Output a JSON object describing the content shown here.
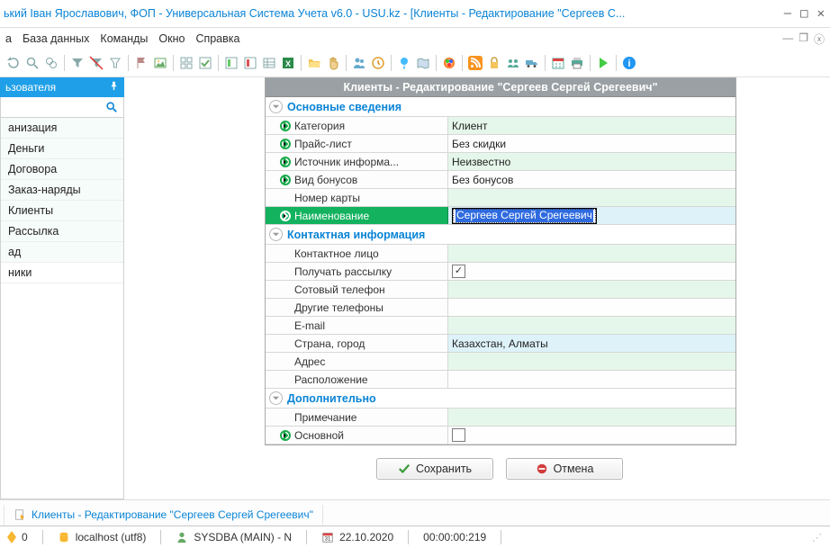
{
  "title": "ький Іван Ярославович, ФОП - Универсальная Система Учета v6.0 - USU.kz - [Клиенты - Редактирование \"Сергеев С...",
  "menu": {
    "m1": "а",
    "m2": "База данных",
    "m3": "Команды",
    "m4": "Окно",
    "m5": "Справка"
  },
  "sidebar": {
    "header": "ьзователя",
    "items": [
      "анизация",
      "Деньги",
      "Договора",
      "Заказ-наряды",
      "Клиенты",
      "Рассылка",
      "ад",
      "ники"
    ]
  },
  "form": {
    "title": "Клиенты - Редактирование \"Сергеев Сергей Срегеевич\"",
    "sections": {
      "main": "Основные сведения",
      "contact": "Контактная информация",
      "extra": "Дополнительно"
    },
    "labels": {
      "category": "Категория",
      "pricelist": "Прайс-лист",
      "source": "Источник информа...",
      "bonus": "Вид бонусов",
      "card": "Номер карты",
      "name": "Наименование",
      "contact_person": "Контактное лицо",
      "mailing": "Получать рассылку",
      "mobile": "Сотовый телефон",
      "phones": "Другие телефоны",
      "email": "E-mail",
      "country": "Страна, город",
      "address": "Адрес",
      "location": "Расположение",
      "note": "Примечание",
      "primary": "Основной"
    },
    "values": {
      "category": "Клиент",
      "pricelist": "Без скидки",
      "source": "Неизвестно",
      "bonus": "Без бонусов",
      "card": "",
      "name": "Сергеев Сергей Срегеевич",
      "contact_person": "",
      "mailing_checked": "✓",
      "mobile": "",
      "phones": "",
      "email": "",
      "country": "Казахстан, Алматы",
      "address": "",
      "location": "",
      "note": "",
      "primary_checked": ""
    },
    "buttons": {
      "save": "Сохранить",
      "cancel": "Отмена"
    }
  },
  "mdi_tab": "Клиенты - Редактирование \"Сергеев Сергей Срегеевич\"",
  "status": {
    "indicator": "0",
    "host": "localhost (utf8)",
    "user": "SYSDBA (MAIN) - N",
    "date": "22.10.2020",
    "timer": "00:00:00:219"
  }
}
